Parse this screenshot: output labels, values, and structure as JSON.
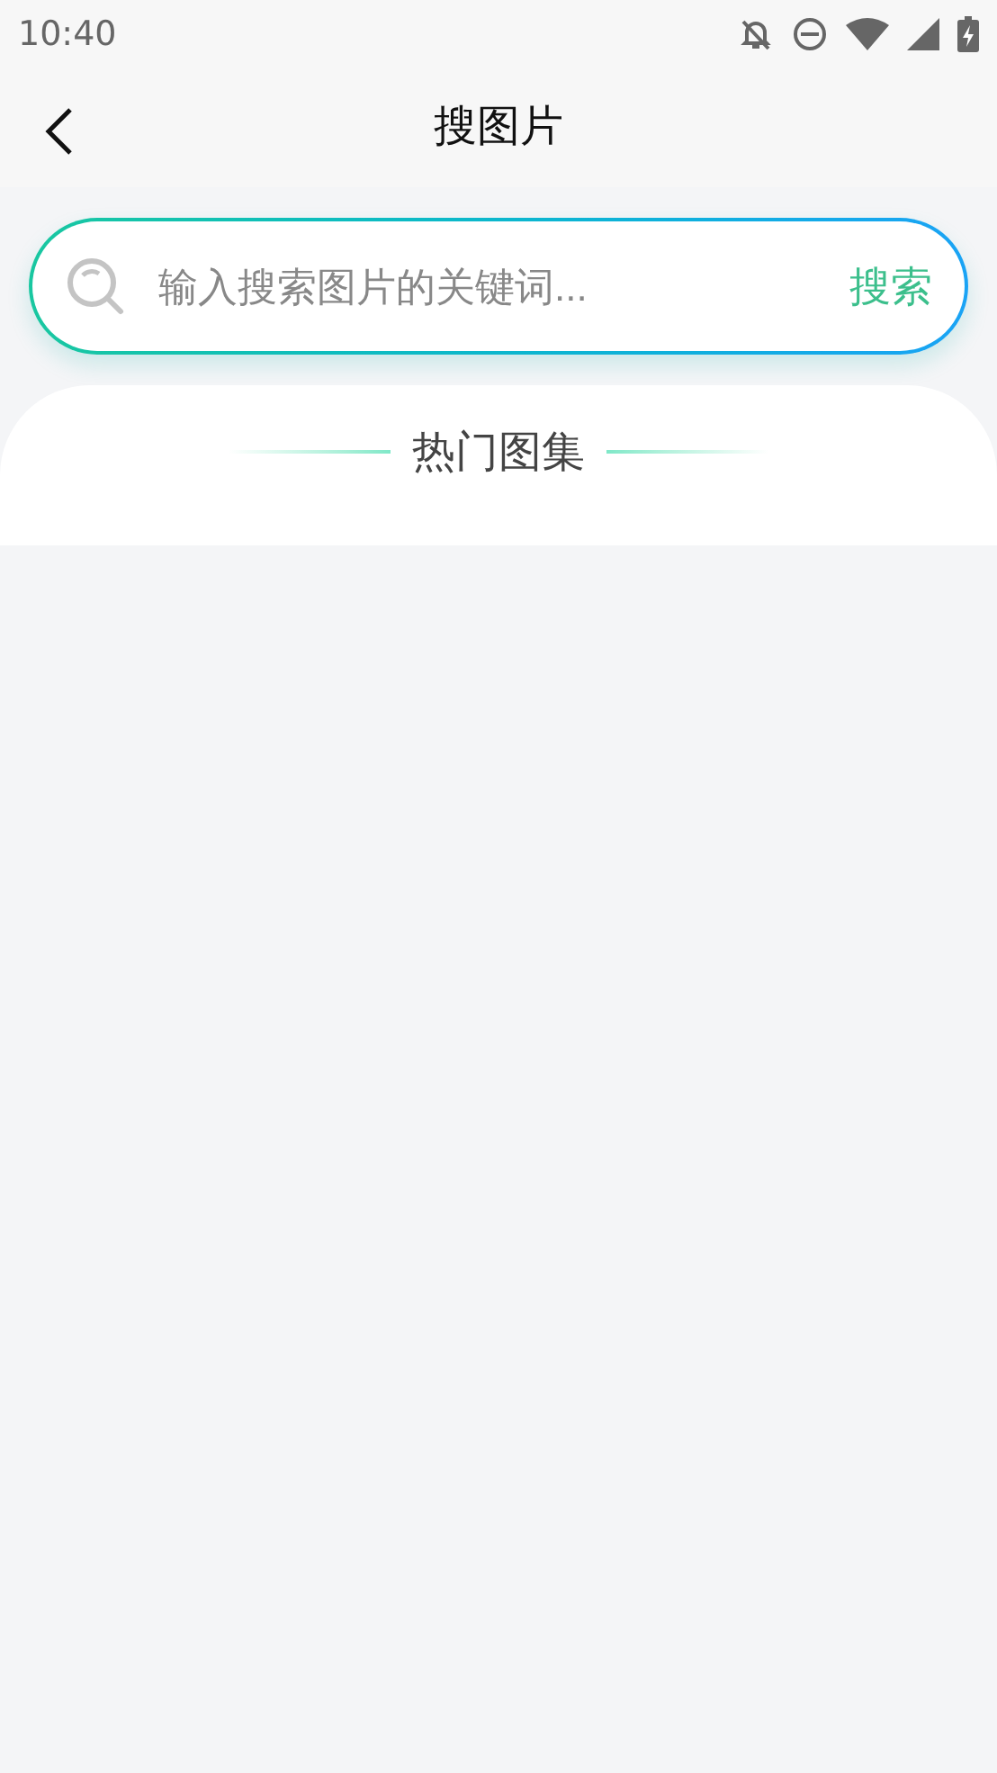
{
  "status_bar": {
    "time": "10:40"
  },
  "header": {
    "title": "搜图片"
  },
  "search": {
    "placeholder": "输入搜索图片的关键词...",
    "button": "搜索"
  },
  "section": {
    "title": "热门图集"
  }
}
